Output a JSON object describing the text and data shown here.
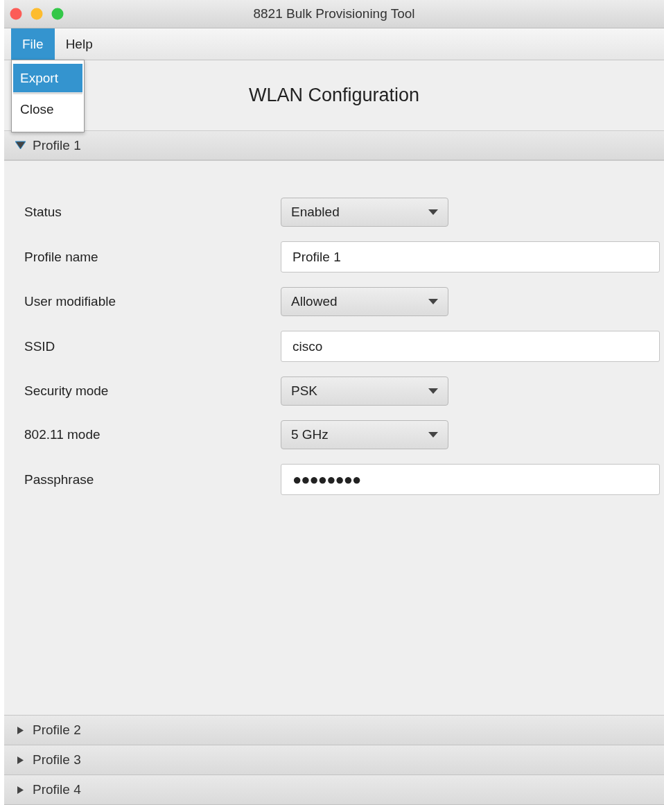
{
  "window": {
    "title": "8821 Bulk Provisioning Tool"
  },
  "menu_bar": [
    {
      "label": "File",
      "selected": true
    },
    {
      "label": "Help",
      "selected": false
    }
  ],
  "file_menu": [
    {
      "label": "Export",
      "selected": true
    },
    {
      "label": "Close",
      "selected": false
    }
  ],
  "heading": "WLAN Configuration",
  "profiles": [
    {
      "title": "Profile 1",
      "expanded": true,
      "fields": [
        {
          "label": "Status",
          "kind": "dropdown",
          "value": "Enabled"
        },
        {
          "label": "Profile name",
          "kind": "text",
          "value": "Profile 1"
        },
        {
          "label": "User modifiable",
          "kind": "dropdown",
          "value": "Allowed"
        },
        {
          "label": "SSID",
          "kind": "text",
          "value": "cisco"
        },
        {
          "label": "Security mode",
          "kind": "dropdown",
          "value": "PSK"
        },
        {
          "label": "802.11 mode",
          "kind": "dropdown",
          "value": "5 GHz"
        },
        {
          "label": "Passphrase",
          "kind": "password",
          "value": "●●●●●●●●"
        }
      ]
    },
    {
      "title": "Profile 2",
      "expanded": false
    },
    {
      "title": "Profile 3",
      "expanded": false
    },
    {
      "title": "Profile 4",
      "expanded": false
    }
  ]
}
